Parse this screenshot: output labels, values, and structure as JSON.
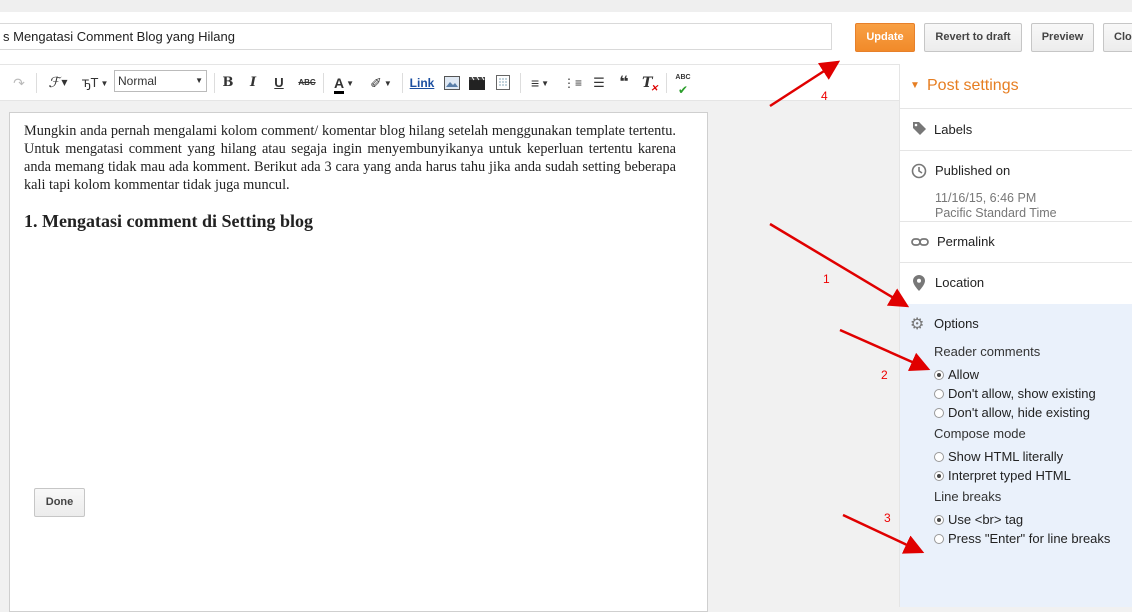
{
  "header": {
    "post_title": "s Mengatasi Comment Blog yang Hilang",
    "update_label": "Update",
    "revert_label": "Revert to draft",
    "preview_label": "Preview",
    "close_label": "Clo"
  },
  "toolbar": {
    "redo_icon": "↷",
    "font_family_icon": "ℱ",
    "font_size_icon": "ꚋT",
    "format_select": "Normal",
    "bold": "B",
    "italic": "I",
    "underline": "U",
    "strikethrough": "ABC",
    "text_color": "A",
    "link_label": "Link",
    "align_icon": "≡",
    "numbered_list_icon": "⋮≡",
    "bullet_list_icon": "☰",
    "quote_icon": "❝",
    "clear_format_icon": "T",
    "spellcheck_label": "ABC"
  },
  "editor": {
    "paragraph": "Mungkin anda pernah mengalami kolom comment/ komentar blog hilang setelah menggunakan template tertentu. Untuk mengatasi comment yang hilang atau segaja ingin menyembunyikanya untuk keperluan tertentu karena anda memang tidak mau ada komment. Berikut ada 3 cara yang anda harus tahu jika anda sudah setting beberapa kali tapi kolom kommentar tidak juga muncul.",
    "heading": "1. Mengatasi comment di Setting blog"
  },
  "sidebar": {
    "title": "Post settings",
    "labels": "Labels",
    "published_on": "Published on",
    "published_date": "11/16/15, 6:46 PM",
    "published_tz": "Pacific Standard Time",
    "permalink": "Permalink",
    "location": "Location",
    "options": {
      "title": "Options",
      "reader_comments_label": "Reader comments",
      "reader_comments": [
        {
          "label": "Allow",
          "selected": true
        },
        {
          "label": "Don't allow, show existing",
          "selected": false
        },
        {
          "label": "Don't allow, hide existing",
          "selected": false
        }
      ],
      "compose_mode_label": "Compose mode",
      "compose_mode": [
        {
          "label": "Show HTML literally",
          "selected": false
        },
        {
          "label": "Interpret typed HTML",
          "selected": true
        }
      ],
      "line_breaks_label": "Line breaks",
      "line_breaks": [
        {
          "label": "Use <br> tag",
          "selected": true
        },
        {
          "label": "Press \"Enter\" for line breaks",
          "selected": false
        }
      ],
      "done_label": "Done"
    }
  },
  "annotations": [
    "4",
    "1",
    "2",
    "3"
  ],
  "colors": {
    "accent": "#e67e22",
    "arrow": "#e00000",
    "options_bg": "#eaf1fb"
  }
}
